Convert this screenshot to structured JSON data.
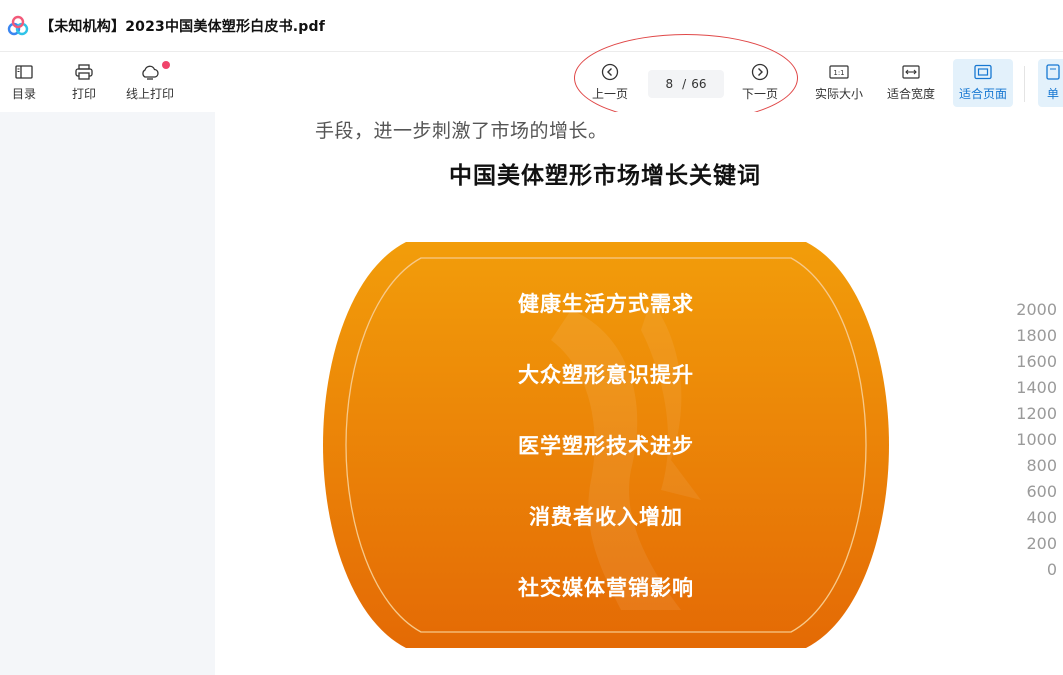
{
  "app": {
    "document_title": "【未知机构】2023中国美体塑形白皮书.pdf"
  },
  "toolbar": {
    "toc_label": "目录",
    "print_label": "打印",
    "online_print_label": "线上打印",
    "prev_label": "上一页",
    "next_label": "下一页",
    "current_page": "8",
    "total_pages": "66",
    "separator": "/",
    "actual_size_label": "实际大小",
    "fit_width_label": "适合宽度",
    "fit_page_label": "适合页面",
    "single_page_label_partial": "单",
    "icons": {
      "toc": "sidebar-panel-icon",
      "print": "printer-icon",
      "online_print": "cloud-icon",
      "prev": "chevron-left-circle-icon",
      "next": "chevron-right-circle-icon",
      "actual_size": "ratio-1-1-icon",
      "fit_width": "fit-width-icon",
      "fit_page": "fit-page-icon"
    }
  },
  "document": {
    "text_line": "手段，进一步刺激了市场的增长。",
    "slide_title": "中国美体塑形市场增长关键词",
    "keywords": [
      "健康生活方式需求",
      "大众塑形意识提升",
      "医学塑形技术进步",
      "消费者收入增加",
      "社交媒体营销影响"
    ],
    "partial_axis_ticks": [
      "2000",
      "1800",
      "1600",
      "1400",
      "1200",
      "1000",
      "800",
      "600",
      "400",
      "200",
      "0"
    ]
  },
  "colors": {
    "accent_blue": "#1677d2",
    "active_bg": "#e3f1fb",
    "badge_top": "#f29d0a",
    "badge_bottom": "#e46a05",
    "annotation_red": "#e04848",
    "notification_dot": "#f0436a"
  }
}
